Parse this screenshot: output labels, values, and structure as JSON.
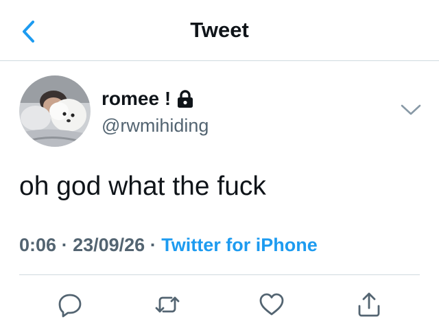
{
  "header": {
    "back_icon": "chevron-left-icon",
    "title": "Tweet"
  },
  "tweet": {
    "display_name": "romee !",
    "lock_icon": "lock-icon",
    "username": "@rwmihiding",
    "text": "oh god what the fuck",
    "time": "0:06",
    "date": "23/09/26",
    "separator": "·",
    "source": "Twitter for iPhone",
    "options_icon": "chevron-down-icon"
  },
  "actions": [
    {
      "name": "reply",
      "icon": "reply-icon"
    },
    {
      "name": "retweet",
      "icon": "retweet-icon"
    },
    {
      "name": "like",
      "icon": "heart-icon"
    },
    {
      "name": "share",
      "icon": "share-icon"
    }
  ],
  "colors": {
    "accent": "#1d9bf0",
    "text_primary": "#0f1419",
    "text_secondary": "#536471",
    "divider": "#cfd9de"
  }
}
